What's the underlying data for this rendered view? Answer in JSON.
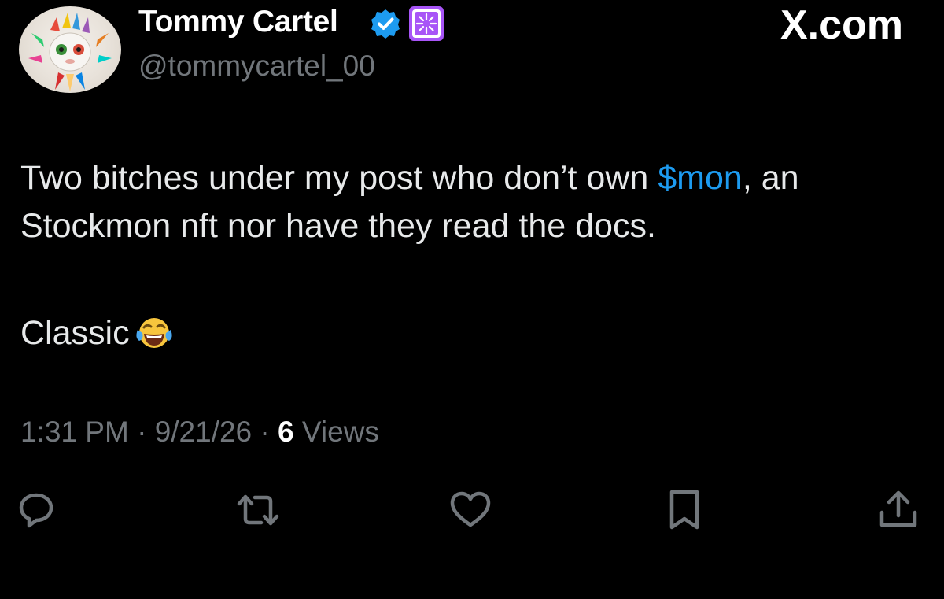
{
  "header": {
    "display_name": "Tommy Cartel",
    "handle": "@tommycartel_00",
    "site_label": "X.com",
    "verified_color": "#1d9bf0",
    "affiliate_color": "#a855f7"
  },
  "post": {
    "line1_before": "Two bitches under my post who don’t own ",
    "cashtag": "$mon",
    "line1_after": ", an",
    "line2": "Stockmon nft nor have they read the docs.",
    "line3": "Classic",
    "emoji": "face-with-tears-of-joy",
    "cashtag_color": "#1d9bf0"
  },
  "meta": {
    "time": "1:31 PM",
    "sep1": " · ",
    "date": "9/21/26",
    "sep2": " · ",
    "views_count": "6",
    "views_label": " Views"
  },
  "actions": {
    "reply_icon": "reply-icon",
    "repost_icon": "repost-icon",
    "like_icon": "heart-icon",
    "bookmark_icon": "bookmark-icon",
    "share_icon": "share-icon"
  }
}
